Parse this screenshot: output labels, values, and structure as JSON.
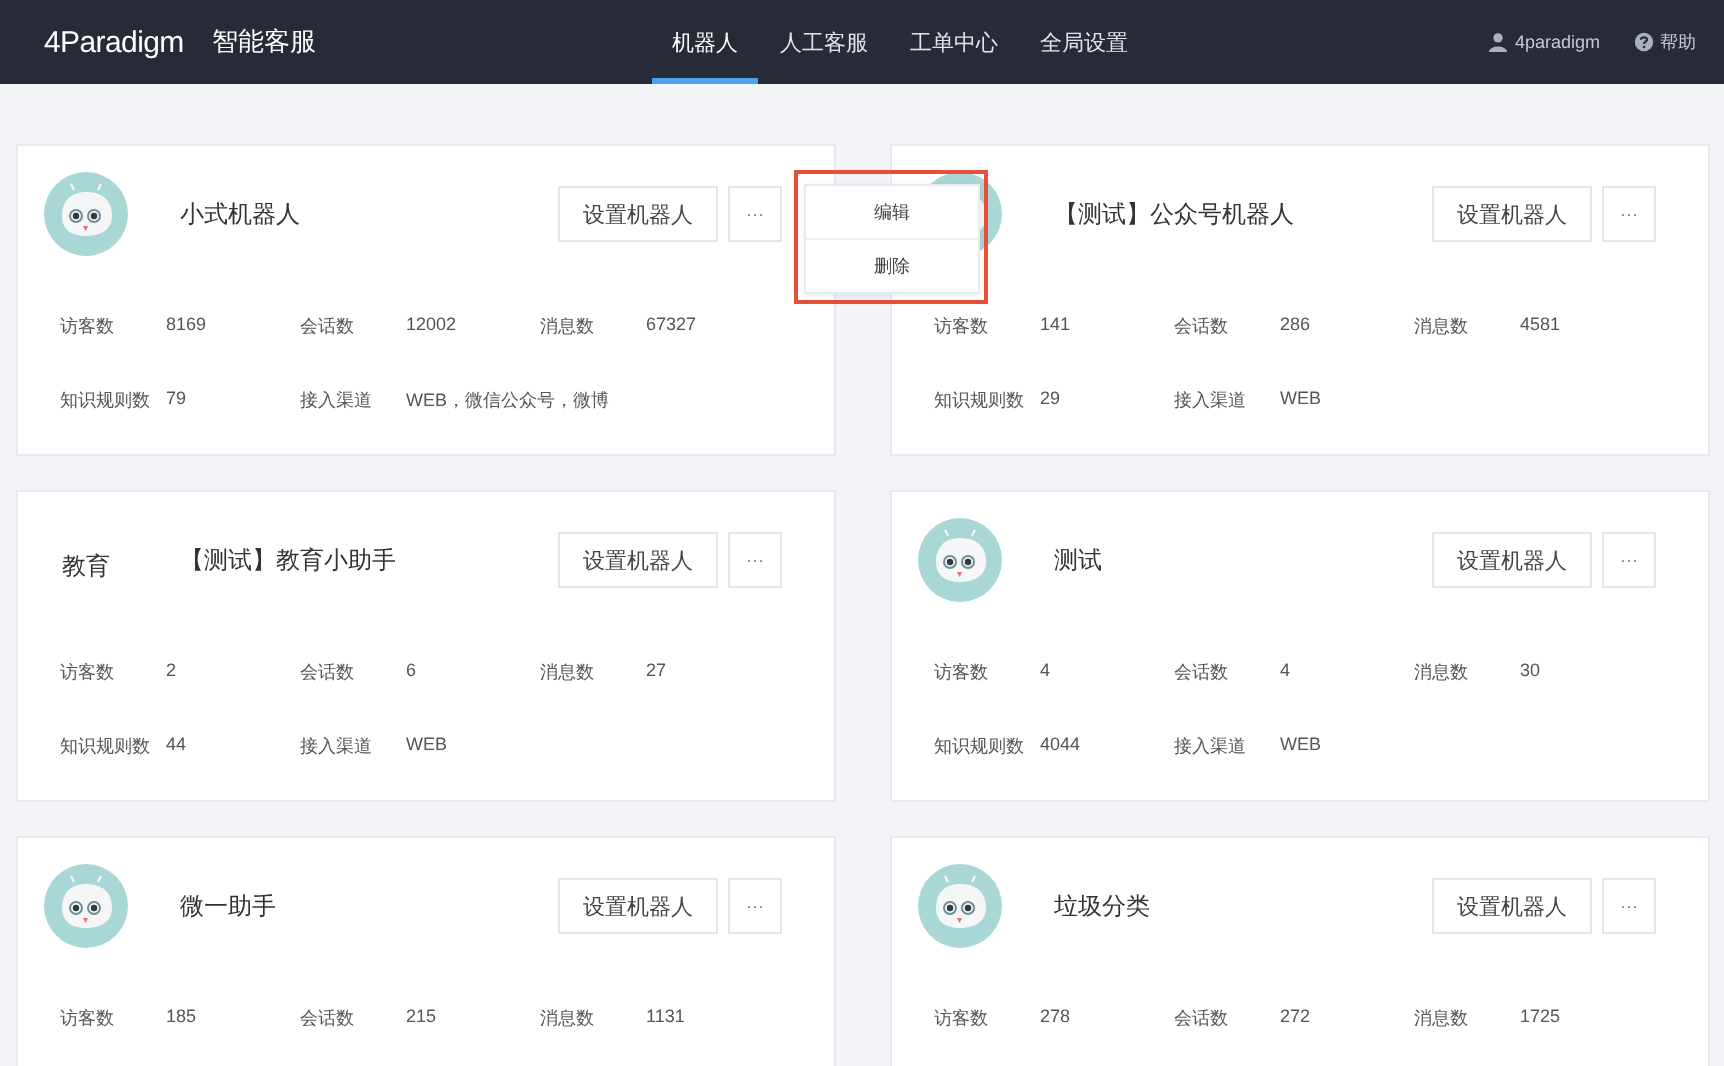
{
  "header": {
    "logo": "4Paradigm",
    "product": "智能客服",
    "nav": [
      {
        "label": "机器人",
        "selected": true
      },
      {
        "label": "人工客服",
        "selected": false
      },
      {
        "label": "工单中心",
        "selected": false
      },
      {
        "label": "全局设置",
        "selected": false
      }
    ],
    "user": "4paradigm",
    "help": "帮助"
  },
  "robots": [
    {
      "avatar": {
        "kind": "robot"
      },
      "name": "小式机器人",
      "setup_button": "设置机器人",
      "more_button": "···",
      "stat_rows": [
        [
          {
            "label": "访客数",
            "value": "8169"
          },
          {
            "label": "会话数",
            "value": "12002"
          },
          {
            "label": "消息数",
            "value": "67327"
          }
        ],
        [
          {
            "label": "知识规则数",
            "value": "79"
          },
          {
            "label": "接入渠道",
            "value": "WEB，微信公众号，微博"
          }
        ]
      ]
    },
    {
      "avatar": {
        "kind": "robot"
      },
      "name": "【测试】公众号机器人",
      "setup_button": "设置机器人",
      "more_button": "···",
      "stat_rows": [
        [
          {
            "label": "访客数",
            "value": "141"
          },
          {
            "label": "会话数",
            "value": "286"
          },
          {
            "label": "消息数",
            "value": "4581"
          }
        ],
        [
          {
            "label": "知识规则数",
            "value": "29"
          },
          {
            "label": "接入渠道",
            "value": "WEB"
          }
        ]
      ]
    },
    {
      "avatar": {
        "kind": "text",
        "text": "教育"
      },
      "name": "【测试】教育小助手",
      "setup_button": "设置机器人",
      "more_button": "···",
      "stat_rows": [
        [
          {
            "label": "访客数",
            "value": "2"
          },
          {
            "label": "会话数",
            "value": "6"
          },
          {
            "label": "消息数",
            "value": "27"
          }
        ],
        [
          {
            "label": "知识规则数",
            "value": "44"
          },
          {
            "label": "接入渠道",
            "value": "WEB"
          }
        ]
      ]
    },
    {
      "avatar": {
        "kind": "robot"
      },
      "name": "测试",
      "setup_button": "设置机器人",
      "more_button": "···",
      "stat_rows": [
        [
          {
            "label": "访客数",
            "value": "4"
          },
          {
            "label": "会话数",
            "value": "4"
          },
          {
            "label": "消息数",
            "value": "30"
          }
        ],
        [
          {
            "label": "知识规则数",
            "value": "4044"
          },
          {
            "label": "接入渠道",
            "value": "WEB"
          }
        ]
      ]
    },
    {
      "avatar": {
        "kind": "robot"
      },
      "name": "微一助手",
      "setup_button": "设置机器人",
      "more_button": "···",
      "stat_rows": [
        [
          {
            "label": "访客数",
            "value": "185"
          },
          {
            "label": "会话数",
            "value": "215"
          },
          {
            "label": "消息数",
            "value": "1131"
          }
        ]
      ]
    },
    {
      "avatar": {
        "kind": "robot"
      },
      "name": "垃圾分类",
      "setup_button": "设置机器人",
      "more_button": "···",
      "stat_rows": [
        [
          {
            "label": "访客数",
            "value": "278"
          },
          {
            "label": "会话数",
            "value": "272"
          },
          {
            "label": "消息数",
            "value": "1725"
          }
        ]
      ]
    }
  ],
  "dropdown_menu": {
    "items": [
      "编辑",
      "删除"
    ]
  }
}
